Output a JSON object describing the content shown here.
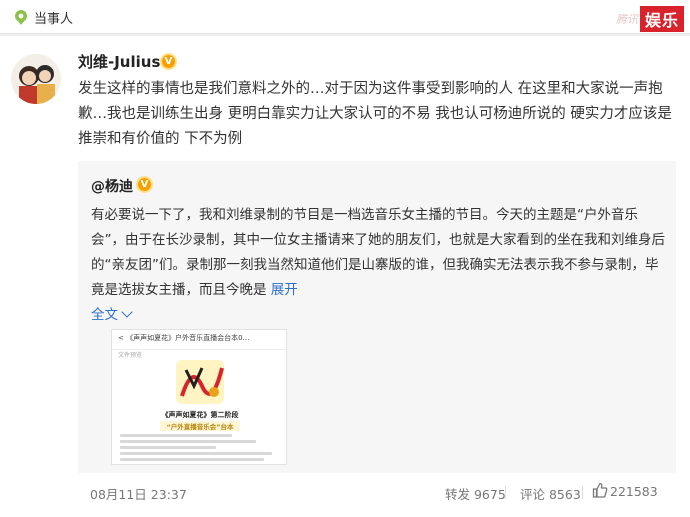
{
  "topbar": {
    "tag_label": "当事人",
    "watermark": "腾讯",
    "brand_logo": "娱乐"
  },
  "post": {
    "author": "刘维-Julius",
    "verified": "V",
    "text": "发生这样的事情也是我们意料之外的…对于因为这件事受到影响的人 在这里和大家说一声抱歉…我也是训练生出身 更明白靠实力让大家认可的不易 我也认可杨迪所说的 硬实力才应该是推崇和有价值的 下不为例"
  },
  "repost": {
    "author": "@杨迪",
    "verified": "V",
    "text": "有必要说一下了，我和刘维录制的节目是一档选音乐女主播的节目。今天的主题是“户外音乐会”，由于在长沙录制，其中一位女主播请来了她的朋友们，也就是大家看到的坐在我和刘维身后的“亲友团”们。录制那一刻我当然知道他们是山寨版的谁，但我确实无法表示我不参与录制，毕竟是选拔女主播，而且今晚是",
    "expand_label": "展开",
    "full_text_label": "全文",
    "thumbnail": {
      "bar_title": "《声声如夏花》户外音乐直播会台本0…",
      "bar_sub": "文件预览",
      "doc_title": "《声声如夏花》第二阶段",
      "doc_subtitle": "“户外直播音乐会”台本"
    }
  },
  "footer": {
    "time": "08月11日 23:37",
    "repost_label": "转发 9675",
    "comment_label": "评论 8563",
    "like_count": "221583"
  },
  "colors": {
    "link": "#2f6fcb",
    "badge": "#f7a100",
    "brand": "#d9232c"
  }
}
